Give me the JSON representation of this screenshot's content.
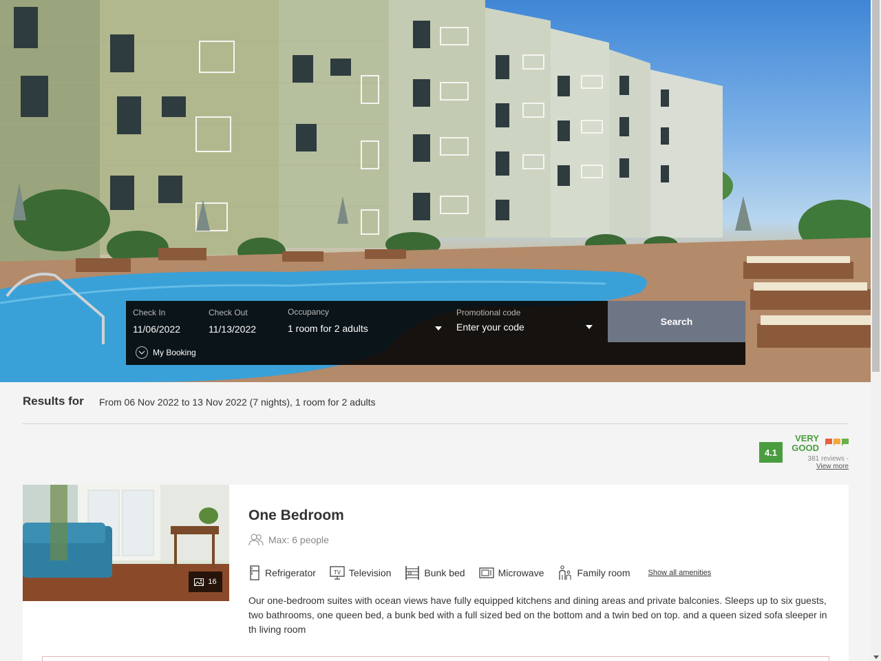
{
  "booking": {
    "check_in_label": "Check In",
    "check_in_value": "11/06/2022",
    "check_out_label": "Check Out",
    "check_out_value": "11/13/2022",
    "occupancy_label": "Occupancy",
    "occupancy_value": "1 room for 2 adults",
    "promo_label": "Promotional code",
    "promo_placeholder": "Enter your code",
    "search_label": "Search",
    "my_booking_label": "My Booking"
  },
  "results": {
    "title": "Results for",
    "summary": "From 06 Nov 2022 to 13 Nov 2022 (7 nights), 1 room for 2 adults"
  },
  "rating": {
    "score": "4.1",
    "word_line1": "VERY",
    "word_line2": "GOOD",
    "reviews_text": "381 reviews -",
    "view_more": "View more",
    "flag_colors": [
      "#e8603c",
      "#f2a93b",
      "#6ab04c"
    ]
  },
  "room": {
    "title": "One Bedroom",
    "max_people": "Max: 6 people",
    "photo_count": "16",
    "amenities": [
      {
        "icon": "refrigerator-icon",
        "label": "Refrigerator"
      },
      {
        "icon": "television-icon",
        "label": "Television"
      },
      {
        "icon": "bunk-bed-icon",
        "label": "Bunk bed"
      },
      {
        "icon": "microwave-icon",
        "label": "Microwave"
      },
      {
        "icon": "family-room-icon",
        "label": "Family room"
      }
    ],
    "show_all_amenities": "Show all amenities",
    "description": "Our one-bedroom suites with ocean views have fully equipped kitchens and dining areas and private balconies. Sleeps up to six guests, two bathrooms, one queen bed, a bunk bed with a full sized bed on the bottom and a twin bed on top. and a queen sized sofa sleeper in th living room"
  },
  "colors": {
    "booking_bar": "#080808",
    "search_button": "#6e7584",
    "rating_green": "#4a9d3f"
  }
}
